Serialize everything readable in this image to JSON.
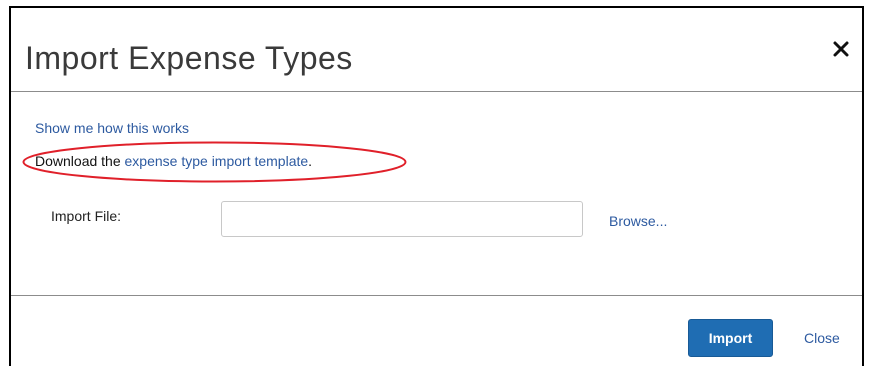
{
  "dialog": {
    "title": "Import Expense Types",
    "close_icon": "close-icon"
  },
  "body": {
    "show_me_link": "Show me how this works",
    "download_prefix": "Download the ",
    "template_link": "expense type import template",
    "download_suffix": ".",
    "import_file_label": "Import File:",
    "import_file_value": "",
    "browse_label": "Browse..."
  },
  "footer": {
    "import_button": "Import",
    "close_link": "Close"
  },
  "colors": {
    "link": "#2d5aa0",
    "primary_button": "#1f6db3",
    "highlight_ellipse": "#e0202a"
  }
}
